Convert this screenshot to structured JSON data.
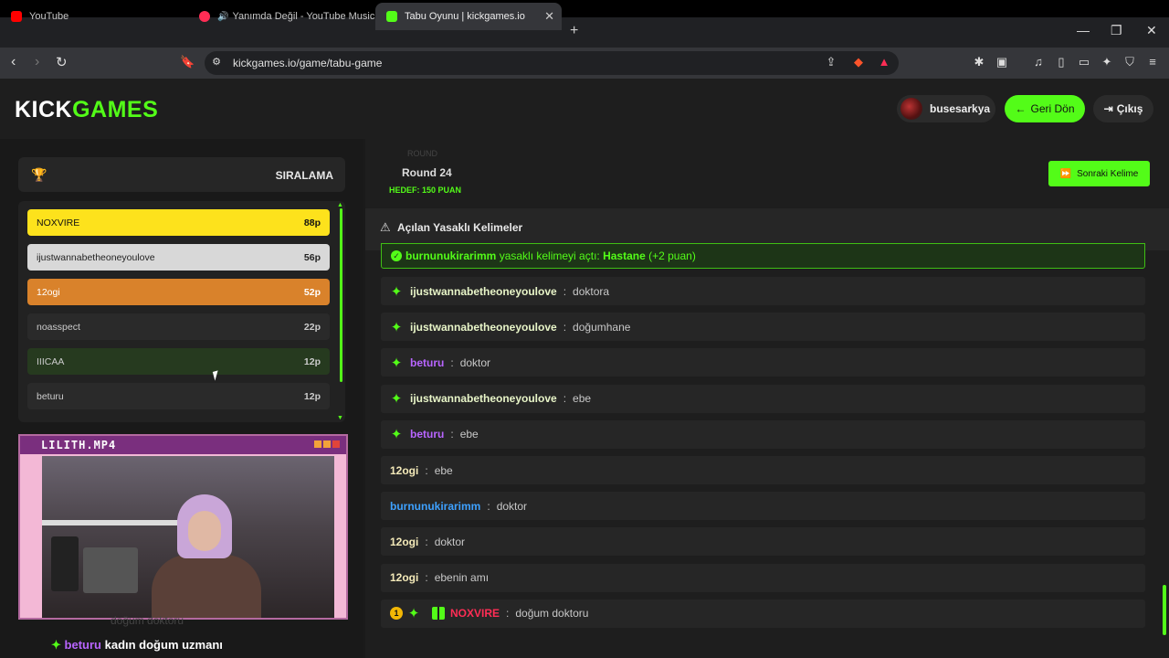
{
  "browser": {
    "tabs": [
      {
        "title": "YouTube",
        "icon": "youtube-icon",
        "color": "#ff0000"
      },
      {
        "title": "Yanımda Değil - YouTube Music",
        "icon": "youtube-music-icon",
        "color": "#ff2d55"
      },
      {
        "title": "Tabu Oyunu | kickgames.io",
        "icon": "kickgames-icon",
        "color": "#53fc18",
        "active": true
      }
    ],
    "url": "kickgames.io/game/tabu-game"
  },
  "header": {
    "logo_kick": "KICK",
    "logo_games": "GAMES",
    "username": "busesarkya",
    "back_label": "Geri Dön",
    "exit_label": "Çıkış"
  },
  "ranking": {
    "title": "SIRALAMA",
    "items": [
      {
        "name": "NOXVIRE",
        "points": "88p",
        "bg": "#fde21c",
        "fg": "#111111"
      },
      {
        "name": "ijustwannabetheoneyoulove",
        "points": "56p",
        "bg": "#d8d8d8",
        "fg": "#222222"
      },
      {
        "name": "12ogi",
        "points": "52p",
        "bg": "#d9822b",
        "fg": "#ffffff"
      },
      {
        "name": "noasspect",
        "points": "22p",
        "bg": "#2a2a2a",
        "fg": "#cccccc"
      },
      {
        "name": "IIICAA",
        "points": "12p",
        "bg": "#263a1f",
        "fg": "#cccccc"
      },
      {
        "name": "beturu",
        "points": "12p",
        "bg": "#2a2a2a",
        "fg": "#cccccc"
      }
    ]
  },
  "webcam": {
    "title": "LILITH.MP4",
    "ghost_text": "doğum doktoru"
  },
  "caption": {
    "user": "beturu",
    "message": "kadın doğum uzmanı"
  },
  "game": {
    "round_faded": "ROUND",
    "round": "Round 24",
    "target": "HEDEF: 150 PUAN",
    "next_label": "Sonraki Kelime",
    "banned_title": "Açılan Yasaklı Kelimeler"
  },
  "alert": {
    "user": "burnunukirarimm",
    "middle": "yasaklı kelimeyi açtı:",
    "word": "Hastane",
    "bonus": "(+2 puan)"
  },
  "messages": [
    {
      "user": "ijustwannabetheoneyoulove",
      "text": "doktora",
      "star": true,
      "color": "#e8f5c8"
    },
    {
      "user": "ijustwannabetheoneyoulove",
      "text": "doğumhane",
      "star": true,
      "color": "#e8f5c8"
    },
    {
      "user": "beturu",
      "text": "doktor",
      "star": true,
      "color": "#b865ff"
    },
    {
      "user": "ijustwannabetheoneyoulove",
      "text": "ebe",
      "star": true,
      "color": "#e8f5c8"
    },
    {
      "user": "beturu",
      "text": "ebe",
      "star": true,
      "color": "#b865ff"
    },
    {
      "user": "12ogi",
      "text": "ebe",
      "star": false,
      "color": "#f3e9b8"
    },
    {
      "user": "burnunukirarimm",
      "text": "doktor",
      "star": false,
      "color": "#3ea1ff"
    },
    {
      "user": "12ogi",
      "text": "doktor",
      "star": false,
      "color": "#f3e9b8"
    },
    {
      "user": "12ogi",
      "text": "ebenin amı",
      "star": false,
      "color": "#f3e9b8"
    },
    {
      "user": "NOXVIRE",
      "text": "doğum doktoru",
      "star": true,
      "badges": true,
      "coin": "1",
      "color": "#ff2d55"
    }
  ]
}
